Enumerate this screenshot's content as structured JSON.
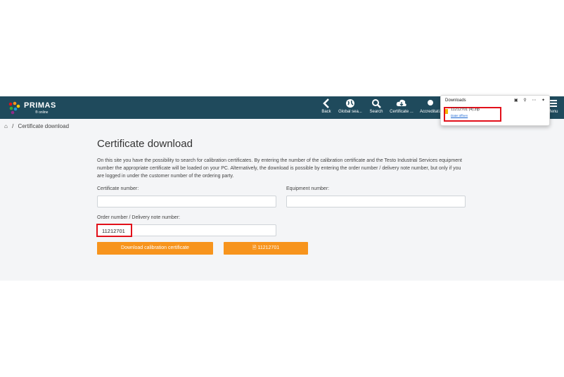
{
  "header": {
    "logo_text": "PRIMAS",
    "logo_sub": "® online",
    "nav": [
      {
        "label": "Back",
        "icon": "chevron-left-icon"
      },
      {
        "label": "Global sea...",
        "icon": "globe-icon"
      },
      {
        "label": "Search",
        "icon": "search-icon"
      },
      {
        "label": "Certificate ...",
        "icon": "cloud-download-icon"
      },
      {
        "label": "Accreditati...",
        "icon": "certificate-icon"
      },
      {
        "label": "Menu",
        "icon": "hamburger-icon"
      }
    ],
    "bg_color": "#1f4a5c"
  },
  "breadcrumb": {
    "home_icon": "home-icon",
    "separator": "/",
    "current": "Certificate download"
  },
  "main": {
    "title": "Certificate download",
    "description": "On this site you have the possibility to search for calibration certificates. By entering the number of the calibration certificate and the Testo Industrial Services equipment number the appropriate certificate will be loaded on your PC. Alternatively, the download is possible by entering the order number / delivery note number, but only if you are logged in under the customer number of the ordering party.",
    "certificate_label": "Certificate number:",
    "certificate_value": "",
    "equipment_label": "Equipment number:",
    "equipment_value": "",
    "order_label": "Order number / Delivery note number:",
    "order_value": "11212701",
    "download_button": "Download calibration certificate",
    "file_button": "11212701",
    "accent_color": "#f7941d"
  },
  "downloads": {
    "title": "Downloads",
    "file_name": "11212701 (4).zip",
    "open_link": "Datei öffnen"
  }
}
